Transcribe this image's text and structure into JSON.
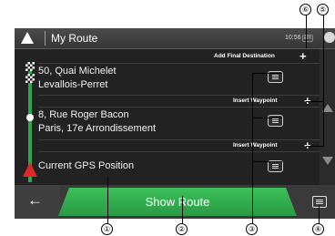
{
  "header": {
    "title": "My Route",
    "clock": "10:56",
    "clock_ampm": "am"
  },
  "route": {
    "add_final_destination": "Add Final Destination",
    "insert_waypoint_1": "Insert Waypoint",
    "insert_waypoint_2": "Insert Waypoint",
    "destination": {
      "line1": "50, Quai Michelet",
      "line2": "Levallois-Perret"
    },
    "waypoint": {
      "line1": "8, Rue Roger Bacon",
      "line2": "Paris, 17e Arrondissement"
    },
    "start": {
      "line1": "Current GPS Position"
    },
    "plus_symbol": "+"
  },
  "footer": {
    "back_symbol": "←",
    "show_route_label": "Show Route"
  },
  "callouts": [
    "⑥",
    "⑤",
    "①",
    "②",
    "③",
    "④"
  ],
  "colors": {
    "accent_green": "#2aa84b",
    "gps_red": "#e02828",
    "background": "#1e1e1e"
  },
  "icons": [
    "navigation-arrow-icon",
    "checkered-flag-icon",
    "waypoint-dot-icon",
    "gps-arrow-icon",
    "menu-icon",
    "plus-icon",
    "back-arrow-icon",
    "scroll-up-icon",
    "scroll-down-icon"
  ]
}
